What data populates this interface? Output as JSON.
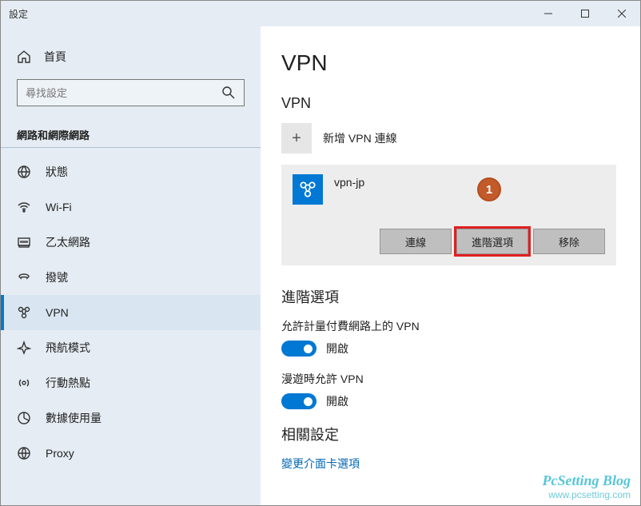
{
  "titlebar": {
    "title": "設定"
  },
  "sidebar": {
    "home": "首頁",
    "search_placeholder": "尋找設定",
    "section": "網路和網際網路",
    "items": [
      {
        "label": "狀態"
      },
      {
        "label": "Wi-Fi"
      },
      {
        "label": "乙太網路"
      },
      {
        "label": "撥號"
      },
      {
        "label": "VPN"
      },
      {
        "label": "飛航模式"
      },
      {
        "label": "行動熱點"
      },
      {
        "label": "數據使用量"
      },
      {
        "label": "Proxy"
      }
    ]
  },
  "main": {
    "title": "VPN",
    "section_vpn": "VPN",
    "add_label": "新增 VPN 連線",
    "vpn_item": {
      "name": "vpn-jp",
      "callout": "1",
      "actions": {
        "connect": "連線",
        "advanced": "進階選項",
        "remove": "移除"
      }
    },
    "advanced_title": "進階選項",
    "toggles": [
      {
        "label": "允許計量付費網路上的 VPN",
        "state": "開啟"
      },
      {
        "label": "漫遊時允許 VPN",
        "state": "開啟"
      }
    ],
    "related_title": "相關設定",
    "related_link": "變更介面卡選項"
  },
  "watermark": {
    "line1": "PcSetting Blog",
    "line2": "www.pcsetting.com"
  }
}
